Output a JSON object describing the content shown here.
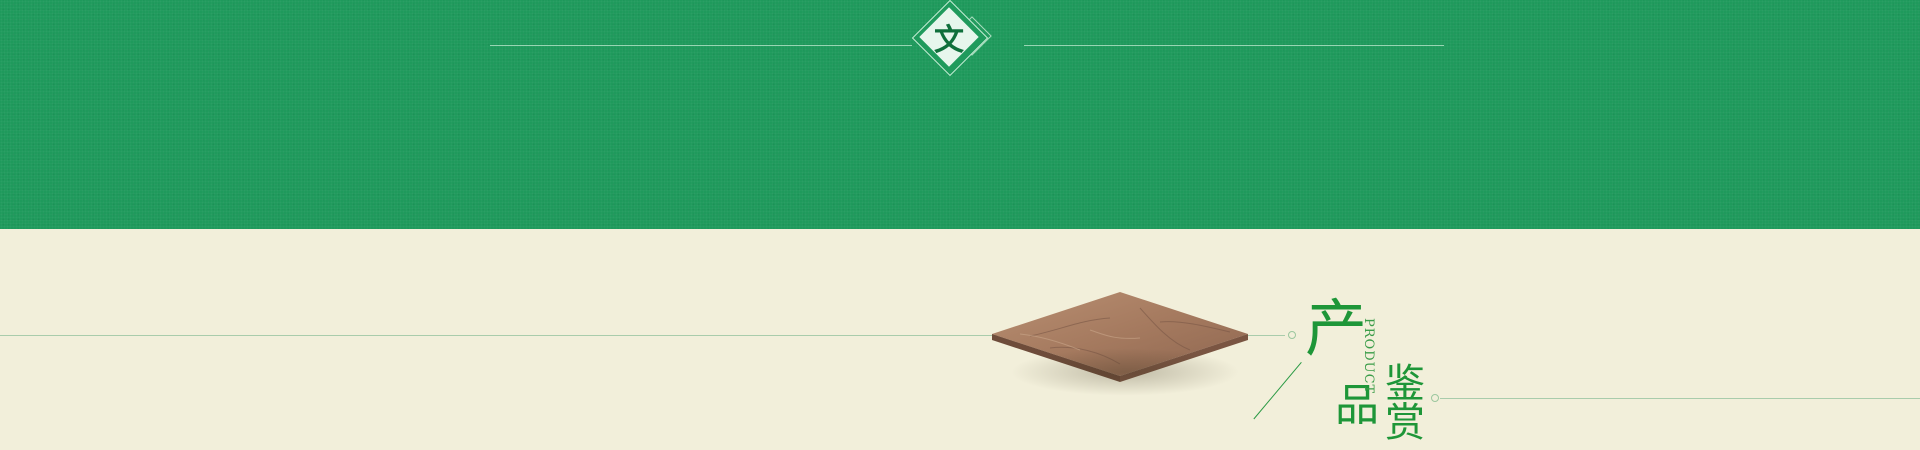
{
  "header": {
    "emblem_char": "文",
    "colors": {
      "band": "#1f9a5c",
      "emblem_fill": "#e6f6ec",
      "emblem_char": "#0f6f3b"
    }
  },
  "section": {
    "title_chars": [
      "产",
      "品",
      "鉴",
      "赏"
    ],
    "english": "PRODUCT",
    "colors": {
      "background": "#f2efda",
      "title": "#1e9638",
      "lines": "#a9ccab"
    }
  },
  "image": {
    "name": "marble tile"
  }
}
